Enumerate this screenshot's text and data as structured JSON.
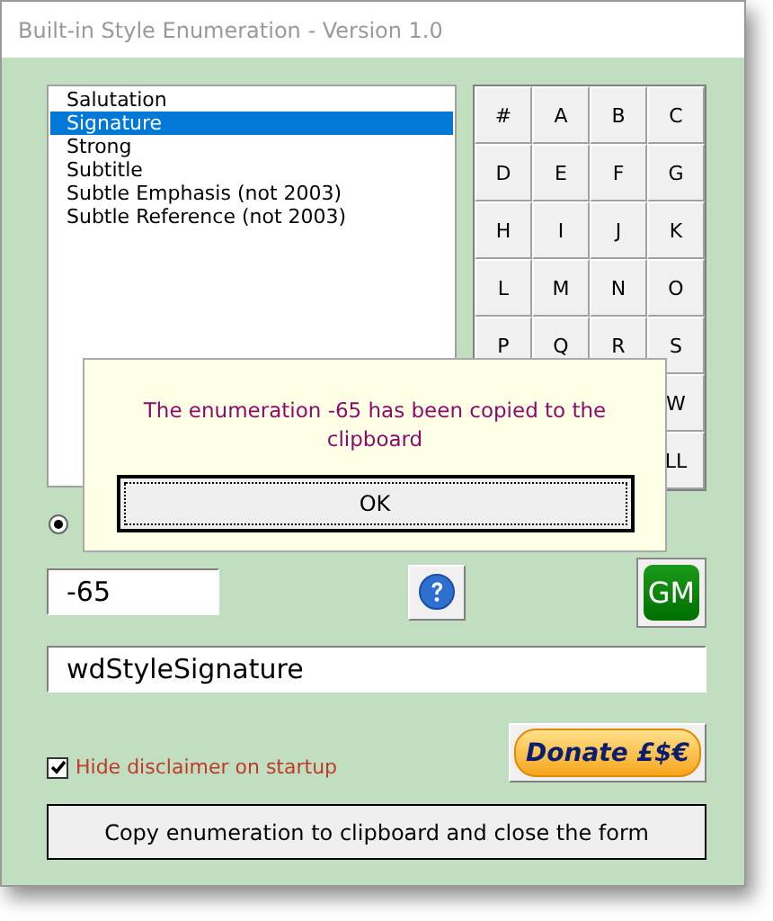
{
  "window": {
    "title": "Built-in Style Enumeration - Version 1.0"
  },
  "styles": [
    {
      "label": "Salutation",
      "selected": false
    },
    {
      "label": "Signature",
      "selected": true
    },
    {
      "label": "Strong",
      "selected": false
    },
    {
      "label": "Subtitle",
      "selected": false
    },
    {
      "label": "Subtle Emphasis (not 2003)",
      "selected": false
    },
    {
      "label": "Subtle Reference (not 2003)",
      "selected": false
    }
  ],
  "letter_grid": [
    [
      "#",
      "A",
      "B",
      "C"
    ],
    [
      "D",
      "E",
      "F",
      "G"
    ],
    [
      "H",
      "I",
      "J",
      "K"
    ],
    [
      "L",
      "M",
      "N",
      "O"
    ],
    [
      "P",
      "Q",
      "R",
      "S"
    ],
    [
      "W"
    ],
    [
      "LL"
    ]
  ],
  "radio": {
    "selected": true
  },
  "enumeration_field": {
    "value": "-65"
  },
  "gm_button": {
    "label": "GM"
  },
  "constant_field": {
    "value": "wdStyleSignature"
  },
  "donate_button": {
    "label": "Donate £$€"
  },
  "disclaimer": {
    "label": "Hide disclaimer on startup",
    "checked": true
  },
  "copy_button": {
    "label": "Copy enumeration to clipboard and close the form"
  },
  "message": {
    "text": "The enumeration -65 has been copied to the clipboard",
    "button": "OK"
  }
}
